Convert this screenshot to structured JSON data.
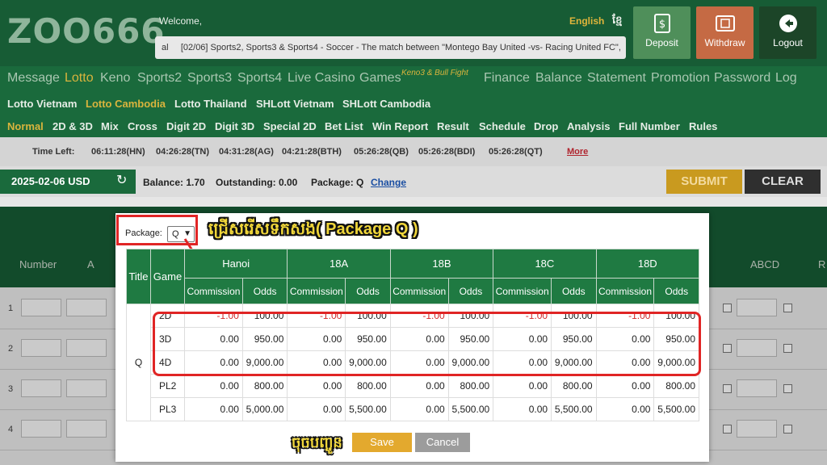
{
  "header": {
    "logo": "ZOO666",
    "welcome": "Welcome,",
    "lang_english": "English",
    "lang_other": "ខ្មែ",
    "ticker": "[02/06] Sports2, Sports3 & Sports4 - Soccer - The match between \"Montego Bay United -vs- Racing United FC\",",
    "ticker_prefix": "al",
    "buttons": {
      "deposit": "Deposit",
      "withdraw": "Withdraw",
      "logout": "Logout"
    }
  },
  "nav_main": {
    "items": [
      "Message",
      "Lotto",
      "Keno",
      "Sports2",
      "Sports3",
      "Sports4",
      "Live Casino",
      "Games",
      "Finance",
      "Balance",
      "Statement",
      "Promotion",
      "Password",
      "Log"
    ],
    "games_sup": "Keno3 & Bull Fight",
    "selected": "Lotto"
  },
  "nav_lotto": {
    "items": [
      "Lotto Vietnam",
      "Lotto Cambodia",
      "Lotto Thailand",
      "SHLott Vietnam",
      "SHLott Cambodia"
    ],
    "selected": "Lotto Cambodia"
  },
  "nav_sub": {
    "items": [
      "Normal",
      "2D & 3D",
      "Mix",
      "Cross",
      "Digit 2D",
      "Digit 3D",
      "Special 2D",
      "Bet List",
      "Win Report",
      "Result",
      "Schedule",
      "Drop",
      "Analysis",
      "Full Number",
      "Rules"
    ],
    "selected": "Normal"
  },
  "timebar": {
    "label": "Time Left:",
    "times": [
      "06:11:28(HN)",
      "04:26:28(TN)",
      "04:31:28(AG)",
      "04:21:28(BTH)",
      "05:26:28(QB)",
      "05:26:28(BDI)",
      "05:26:28(QT)"
    ],
    "more": "More"
  },
  "control": {
    "date": "2025-02-06 USD",
    "balance": "Balance: 1.70",
    "outstanding": "Outstanding: 0.00",
    "package": "Package: Q",
    "change": "Change",
    "submit": "SUBMIT",
    "clear": "CLEAR"
  },
  "bg_table": {
    "headers": {
      "number": "Number",
      "a": "A",
      "abcd": "ABCD",
      "r": "R"
    },
    "rows": [
      "1",
      "2",
      "3",
      "4"
    ]
  },
  "modal": {
    "package_label": "Package:",
    "package_value": "Q",
    "annotation_top": "ជ្រើសរើសទឹកសង( Package Q )",
    "annotation_bottom": "ចុចបញ្ចូន",
    "save": "Save",
    "cancel": "Cancel",
    "table": {
      "title_header": "Title",
      "game_header": "Game",
      "regions": [
        "Hanoi",
        "18A",
        "18B",
        "18C",
        "18D"
      ],
      "sub_commission": "Commission",
      "sub_odds": "Odds",
      "title_value": "Q",
      "rows": [
        {
          "game": "2D",
          "cells": [
            "-1.00",
            "100.00",
            "-1.00",
            "100.00",
            "-1.00",
            "100.00",
            "-1.00",
            "100.00",
            "-1.00",
            "100.00"
          ]
        },
        {
          "game": "3D",
          "cells": [
            "0.00",
            "950.00",
            "0.00",
            "950.00",
            "0.00",
            "950.00",
            "0.00",
            "950.00",
            "0.00",
            "950.00"
          ]
        },
        {
          "game": "4D",
          "cells": [
            "0.00",
            "9,000.00",
            "0.00",
            "9,000.00",
            "0.00",
            "9,000.00",
            "0.00",
            "9,000.00",
            "0.00",
            "9,000.00"
          ]
        },
        {
          "game": "PL2",
          "cells": [
            "0.00",
            "800.00",
            "0.00",
            "800.00",
            "0.00",
            "800.00",
            "0.00",
            "800.00",
            "0.00",
            "800.00"
          ]
        },
        {
          "game": "PL3",
          "cells": [
            "0.00",
            "5,000.00",
            "0.00",
            "5,500.00",
            "0.00",
            "5,500.00",
            "0.00",
            "5,500.00",
            "0.00",
            "5,500.00"
          ]
        }
      ]
    }
  },
  "colors": {
    "brand_green": "#175c35",
    "accent_gold": "#d9b43d",
    "highlight_red": "#e02525",
    "negative_red": "#d12a2a"
  }
}
